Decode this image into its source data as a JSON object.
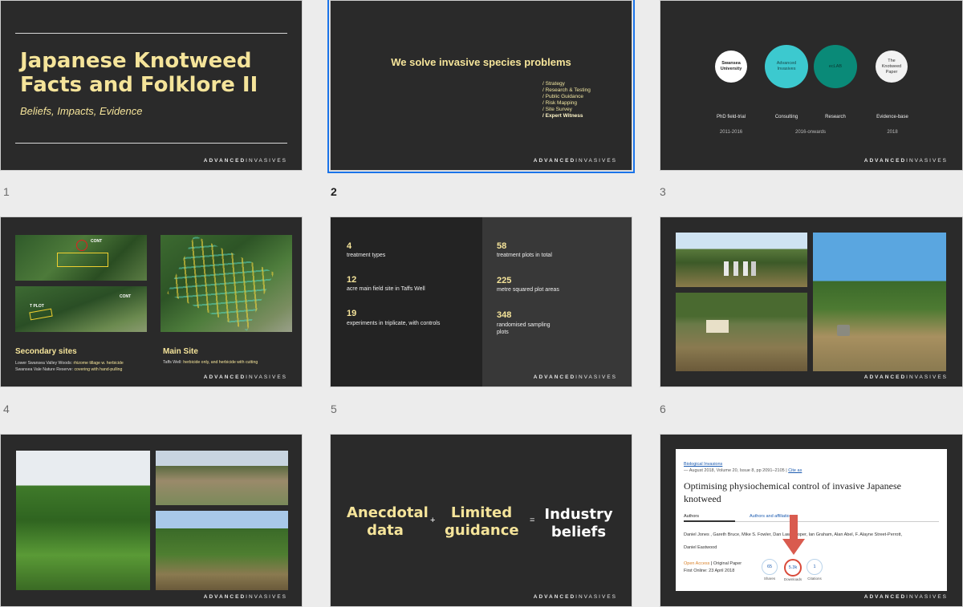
{
  "brand": {
    "bold": "ADVANCED",
    "light": "INVASIVES"
  },
  "slide1": {
    "title_line1": "Japanese Knotweed",
    "title_line2": "Facts and Folklore II",
    "subtitle": "Beliefs, Impacts, Evidence"
  },
  "slide2": {
    "title": "We solve invasive species problems",
    "items": [
      "/ Strategy",
      "/ Research & Testing",
      "/ Public Guidance",
      "/ Risk Mapping",
      "/ Site Survey"
    ],
    "highlight": "/ Expert Witness"
  },
  "slide3": {
    "circles": [
      "Swansea University",
      "Advanced Invasives",
      "ecLAB",
      "The Knotweed Paper"
    ],
    "labels": [
      "PhD field-trial",
      "Consulting",
      "Research",
      "Evidence-base"
    ],
    "years": [
      "2011-2016",
      "2016-onwards",
      "2018"
    ]
  },
  "slide4": {
    "secondary_title": "Secondary sites",
    "secondary_line1_a": "Lower Swansea Valley Woods: ",
    "secondary_line1_b": "rhizome tillage w. herbicide",
    "secondary_line2_a": "Swansea Vale Nature Reserve: ",
    "secondary_line2_b": "covering with hand-pulling",
    "main_title": "Main Site",
    "main_line_a": "Taffs Well: ",
    "main_line_b": "herbicide only, and herbicide with cutting",
    "map_labels": [
      "CONT",
      "A",
      "C",
      "B",
      "D",
      "E",
      "F",
      "CONT",
      "T PLOT"
    ]
  },
  "slide5": {
    "left": [
      {
        "num": "4",
        "label": "treatment types"
      },
      {
        "num": "12",
        "label": "acre main field site in Taffs Well"
      },
      {
        "num": "19",
        "label": "experiments in triplicate, with controls"
      }
    ],
    "right": [
      {
        "num": "58",
        "label": "treatment plots in total"
      },
      {
        "num": "225",
        "label": "metre squared plot areas"
      },
      {
        "num": "348",
        "label": "randomised sampling plots"
      }
    ]
  },
  "slide8": {
    "term1": "Anecdotal data",
    "plus": "+",
    "term2": "Limited guidance",
    "equals": "=",
    "result": "Industry beliefs"
  },
  "slide9": {
    "journal": "Biological Invasions",
    "meta": "August 2018, Volume 20, Issue 8, pp 2091–2105",
    "cite": "Cite as",
    "title": "Optimising physiochemical control of invasive Japanese knotweed",
    "tab_authors": "Authors",
    "tab_aff": "Authors and affiliations",
    "authors_line1": "Daniel Jones , Gareth Bruce, Mike S. Fowler, Dan Law-Cooper, Ian Graham, Alan Abel, F. Alayne Street-Perrott,",
    "authors_line2": "Daniel Eastwood",
    "open_access": "Open Access",
    "paper_type": "Original Paper",
    "first_online": "First Online: 23 April 2018",
    "metrics": [
      {
        "value": "65",
        "label": "Shares"
      },
      {
        "value": "5.3k",
        "label": "Downloads"
      },
      {
        "value": "1",
        "label": "Citations"
      }
    ]
  },
  "slide_numbers": [
    "1",
    "2",
    "3",
    "4",
    "5",
    "6"
  ]
}
